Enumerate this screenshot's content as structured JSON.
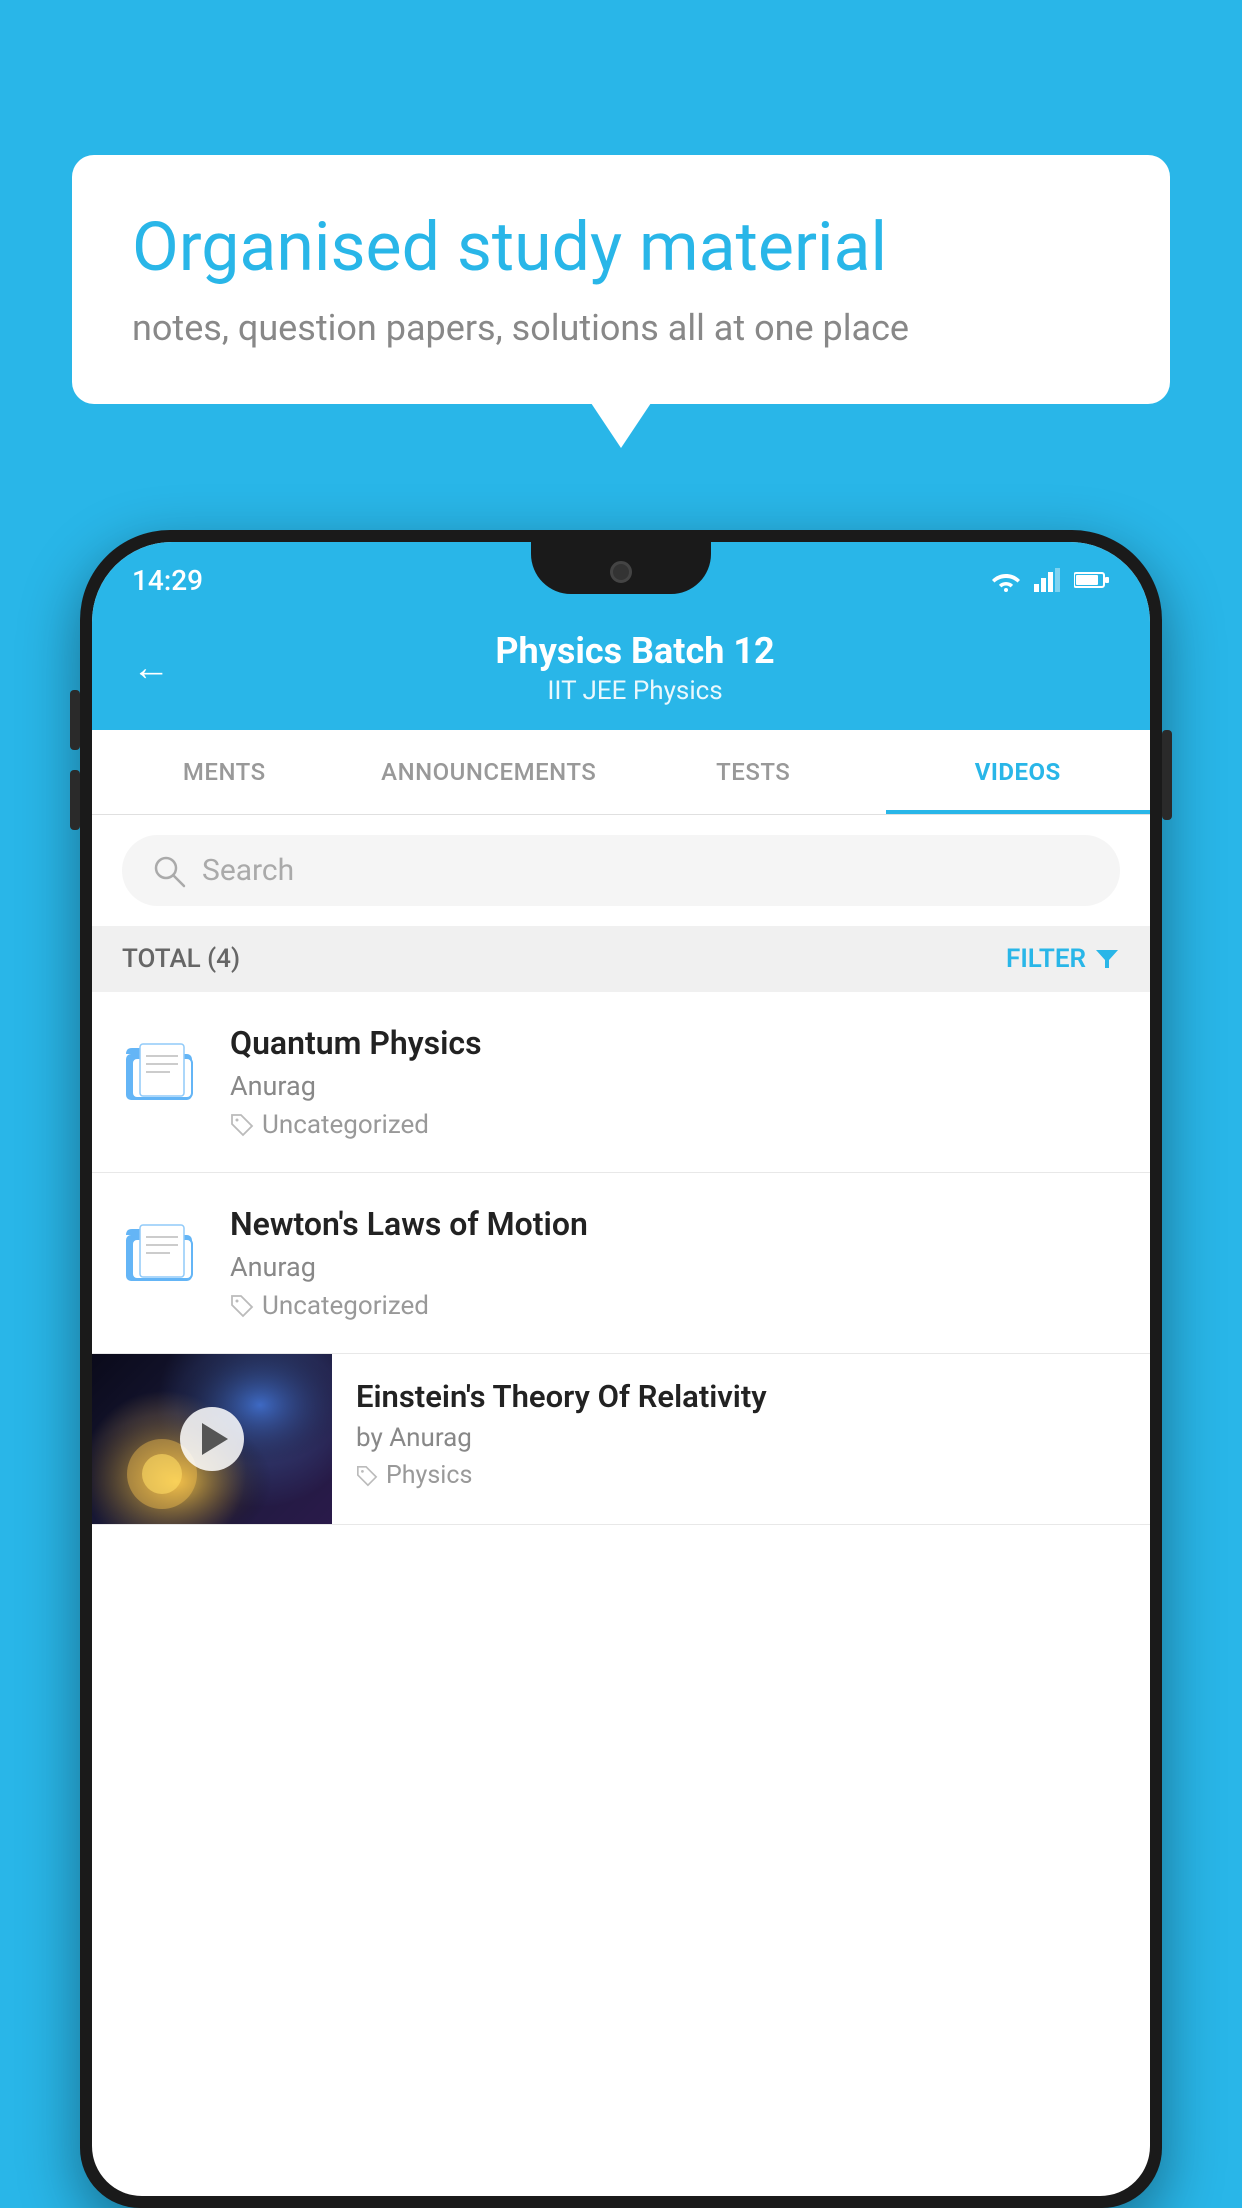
{
  "background_color": "#29b6e8",
  "speech_bubble": {
    "title": "Organised study material",
    "subtitle": "notes, question papers, solutions all at one place"
  },
  "status_bar": {
    "time": "14:29",
    "wifi": "▼",
    "signal": "▲",
    "battery": "▮"
  },
  "header": {
    "back_label": "←",
    "title": "Physics Batch 12",
    "subtitle": "IIT JEE   Physics"
  },
  "tabs": [
    {
      "label": "MENTS",
      "active": false
    },
    {
      "label": "ANNOUNCEMENTS",
      "active": false
    },
    {
      "label": "TESTS",
      "active": false
    },
    {
      "label": "VIDEOS",
      "active": true
    }
  ],
  "search": {
    "placeholder": "Search"
  },
  "filter_bar": {
    "total_label": "TOTAL (4)",
    "filter_label": "FILTER"
  },
  "list_items": [
    {
      "type": "folder",
      "title": "Quantum Physics",
      "author": "Anurag",
      "tag": "Uncategorized"
    },
    {
      "type": "folder",
      "title": "Newton's Laws of Motion",
      "author": "Anurag",
      "tag": "Uncategorized"
    },
    {
      "type": "video",
      "title": "Einstein's Theory Of Relativity",
      "author": "by Anurag",
      "tag": "Physics"
    }
  ]
}
